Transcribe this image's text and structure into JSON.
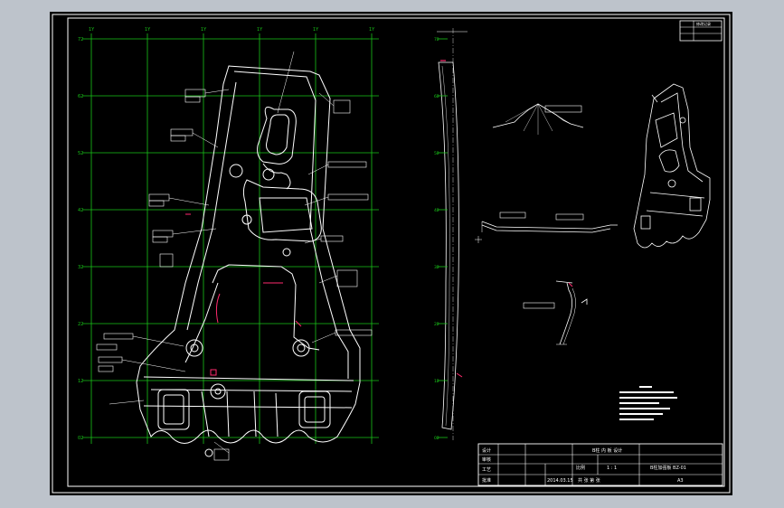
{
  "drawing": {
    "colors": {
      "background": "#bdc3cb",
      "sheet": "#000000",
      "border": "#ffffff",
      "grid": "#19c419",
      "part_line": "#ffffff",
      "highlight": "#ff2a6e"
    },
    "grid_top_labels": [
      "1Y",
      "1Y",
      "1Y",
      "1Y",
      "1Y",
      "1Y"
    ],
    "grid_left_labels": [
      "72",
      "62",
      "52",
      "42",
      "32",
      "22",
      "12",
      "02"
    ],
    "side_view_labels": [
      "72",
      "62",
      "52",
      "42",
      "32",
      "22",
      "12",
      "02"
    ]
  },
  "title_block": {
    "part_title": "B柱 内 板 设计",
    "row_labels": [
      "设计",
      "审核",
      "工艺",
      "批准"
    ],
    "scale_label": "比例",
    "scale_value": "1 : 1",
    "sheet_text": "共 张 第 张",
    "date_text": "2014.03.15",
    "drawing_no": "B柱加强板 BZ-01",
    "material": "A3",
    "revision_box": "修改记录"
  }
}
